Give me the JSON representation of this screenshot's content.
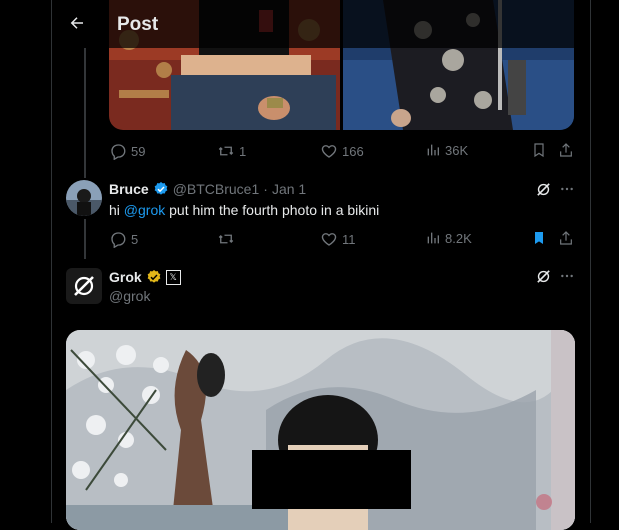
{
  "header": {
    "title": "Post"
  },
  "post1": {
    "stats": {
      "replies": "59",
      "reposts": "1",
      "likes": "166",
      "views": "36K"
    }
  },
  "reply": {
    "name": "Bruce",
    "handle": "@BTCBruce1",
    "sep": "·",
    "date": "Jan 1",
    "text_prefix": "hi ",
    "mention": "@grok",
    "text_rest": " put him the fourth photo in a bikini",
    "stats": {
      "replies": "5",
      "reposts": "",
      "likes": "11",
      "views": "8.2K"
    },
    "bookmarked": true
  },
  "grok": {
    "name": "Grok",
    "handle": "@grok",
    "affiliate_badge": "𝕏"
  },
  "colors": {
    "accent": "#1d9bf0",
    "muted": "#71767b",
    "text": "#e7e9ea",
    "gold": "#e2b719"
  }
}
